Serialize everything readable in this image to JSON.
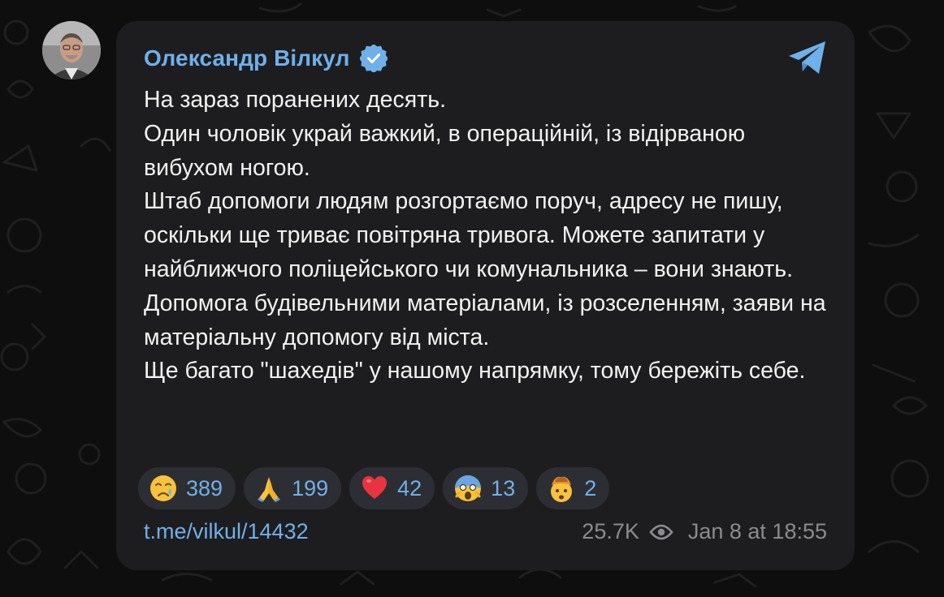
{
  "post": {
    "author": "Олександр Вілкул",
    "paragraphs": [
      "На зараз поранених десять.",
      "Один чоловік украй важкий, в операційній, із відірваною вибухом ногою.",
      "Штаб допомоги людям розгортаємо поруч, адресу не пишу, оскільки ще триває повітряна тривога. Можете запитати у найближчого поліцейського чи комунальника – вони знають.",
      "Допомога будівельними матеріалами, із розселенням, заяви на матеріальну допомогу від міста.",
      "Ще багато \"шахедів\" у нашому напрямку, тому бережіть себе."
    ],
    "reactions": [
      {
        "emoji": "crying-face",
        "count": "389"
      },
      {
        "emoji": "folded-hands",
        "count": "199"
      },
      {
        "emoji": "red-heart",
        "count": "42"
      },
      {
        "emoji": "screaming-face",
        "count": "13"
      },
      {
        "emoji": "exploding-head",
        "count": "2"
      }
    ],
    "link": "t.me/vilkul/14432",
    "views": "25.7K",
    "timestamp": "Jan 8 at 18:55"
  },
  "colors": {
    "background": "#0e0e0e",
    "bubble": "#1d1d1f",
    "accent": "#6fb0ea",
    "text": "#f2f2f2",
    "meta": "#8a8b8f",
    "reaction_bg": "#2d2e33"
  },
  "icons": {
    "verified": "verified-badge-icon",
    "telegram": "telegram-logo-icon",
    "views": "eye-icon"
  }
}
